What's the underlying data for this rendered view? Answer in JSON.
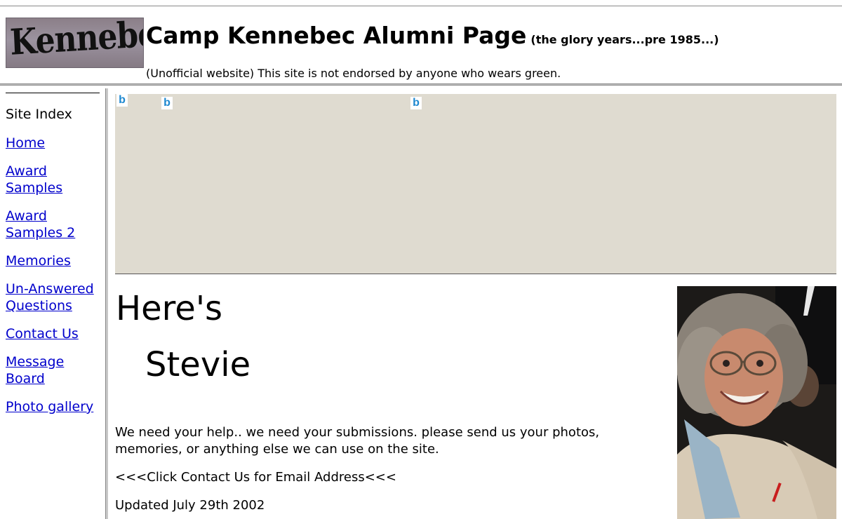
{
  "header": {
    "logo_text": "Kennebec",
    "title": "Camp Kennebec Alumni Page",
    "subtitle": "(the glory years...pre 1985...)",
    "disclaimer": "(Unofficial website) This site is not endorsed by anyone who wears green."
  },
  "sidebar": {
    "heading": "Site Index",
    "links": [
      "Home",
      "Award Samples",
      "Award Samples 2",
      "Memories",
      "Un-Answered Questions",
      "Contact Us",
      "Message Board",
      "Photo gallery"
    ]
  },
  "banner": {
    "icons": [
      "b",
      "b",
      "b"
    ],
    "background_color": "#dfdbd0"
  },
  "main": {
    "greeting_line1": "Here's",
    "greeting_line2": "Stevie",
    "paragraph1": "We need your help.. we need your submissions.  please send us your photos, memories, or anything else we can use on the site.",
    "paragraph2": "<<<Click Contact Us for Email Address<<<",
    "paragraph3": "Updated July 29th 2002"
  },
  "colors": {
    "link": "#0000cc",
    "icon_blue": "#1e88d0"
  }
}
